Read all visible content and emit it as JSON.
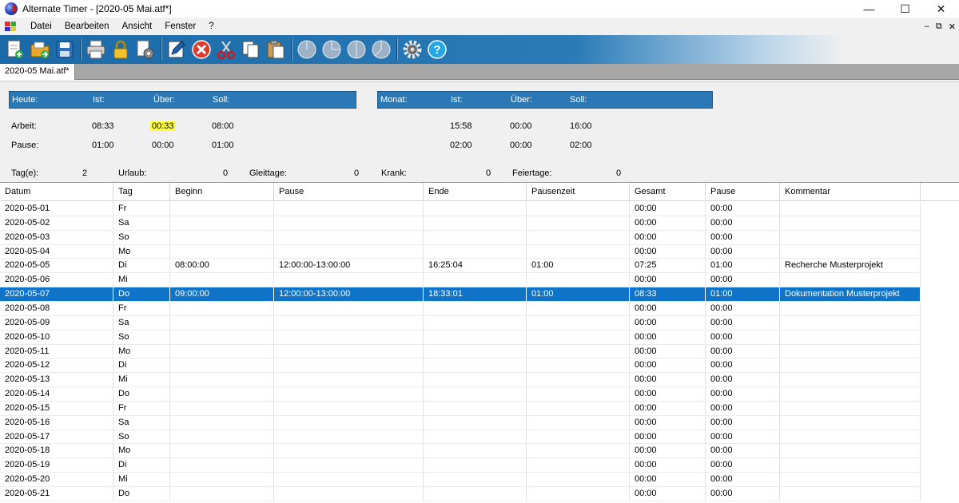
{
  "window": {
    "title": "Alternate Timer - [2020-05 Mai.atf*]"
  },
  "menu": {
    "items": [
      "Datei",
      "Bearbeiten",
      "Ansicht",
      "Fenster",
      "?"
    ]
  },
  "toolbar": {
    "buttons": [
      "new-file",
      "open-folder",
      "save",
      "print",
      "lock",
      "settings-document",
      "edit-note",
      "delete",
      "cut",
      "copy",
      "paste",
      "chart-pie-1",
      "chart-pie-2",
      "chart-pie-3",
      "chart-pie-4",
      "options-gear",
      "help"
    ]
  },
  "tab": {
    "label": "2020-05 Mai.atf*"
  },
  "today": {
    "header": {
      "title": "Heute:",
      "ist": "Ist:",
      "ueber": "Über:",
      "soll": "Soll:"
    },
    "arbeit": {
      "label": "Arbeit:",
      "ist": "08:33",
      "ueber": "00:33",
      "soll": "08:00"
    },
    "pause": {
      "label": "Pause:",
      "ist": "01:00",
      "ueber": "00:00",
      "soll": "01:00"
    }
  },
  "month": {
    "header": {
      "title": "Monat:",
      "ist": "Ist:",
      "ueber": "Über:",
      "soll": "Soll:"
    },
    "arbeit": {
      "ist": "15:58",
      "ueber": "00:00",
      "soll": "16:00"
    },
    "pause": {
      "ist": "02:00",
      "ueber": "00:00",
      "soll": "02:00"
    }
  },
  "counts": {
    "tage_label": "Tag(e):",
    "tage": "2",
    "urlaub_label": "Urlaub:",
    "urlaub": "0",
    "gleittage_label": "Gleittage:",
    "gleittage": "0",
    "krank_label": "Krank:",
    "krank": "0",
    "feiertage_label": "Feiertage:",
    "feiertage": "0"
  },
  "table": {
    "columns": [
      "Datum",
      "Tag",
      "Beginn",
      "Pause",
      "Ende",
      "Pausenzeit",
      "Gesamt",
      "Pause",
      "Kommentar"
    ],
    "selected_index": 6,
    "rows": [
      [
        "2020-05-01",
        "Fr",
        "",
        "",
        "",
        "",
        "00:00",
        "00:00",
        ""
      ],
      [
        "2020-05-02",
        "Sa",
        "",
        "",
        "",
        "",
        "00:00",
        "00:00",
        ""
      ],
      [
        "2020-05-03",
        "So",
        "",
        "",
        "",
        "",
        "00:00",
        "00:00",
        ""
      ],
      [
        "2020-05-04",
        "Mo",
        "",
        "",
        "",
        "",
        "00:00",
        "00:00",
        ""
      ],
      [
        "2020-05-05",
        "Di",
        "08:00:00",
        "12:00:00-13:00:00",
        "16:25:04",
        "01:00",
        "07:25",
        "01:00",
        "Recherche Musterprojekt"
      ],
      [
        "2020-05-06",
        "Mi",
        "",
        "",
        "",
        "",
        "00:00",
        "00:00",
        ""
      ],
      [
        "2020-05-07",
        "Do",
        "09:00:00",
        "12:00:00-13:00:00",
        "18:33:01",
        "01:00",
        "08:33",
        "01:00",
        "Dokumentation Musterprojekt"
      ],
      [
        "2020-05-08",
        "Fr",
        "",
        "",
        "",
        "",
        "00:00",
        "00:00",
        ""
      ],
      [
        "2020-05-09",
        "Sa",
        "",
        "",
        "",
        "",
        "00:00",
        "00:00",
        ""
      ],
      [
        "2020-05-10",
        "So",
        "",
        "",
        "",
        "",
        "00:00",
        "00:00",
        ""
      ],
      [
        "2020-05-11",
        "Mo",
        "",
        "",
        "",
        "",
        "00:00",
        "00:00",
        ""
      ],
      [
        "2020-05-12",
        "Di",
        "",
        "",
        "",
        "",
        "00:00",
        "00:00",
        ""
      ],
      [
        "2020-05-13",
        "Mi",
        "",
        "",
        "",
        "",
        "00:00",
        "00:00",
        ""
      ],
      [
        "2020-05-14",
        "Do",
        "",
        "",
        "",
        "",
        "00:00",
        "00:00",
        ""
      ],
      [
        "2020-05-15",
        "Fr",
        "",
        "",
        "",
        "",
        "00:00",
        "00:00",
        ""
      ],
      [
        "2020-05-16",
        "Sa",
        "",
        "",
        "",
        "",
        "00:00",
        "00:00",
        ""
      ],
      [
        "2020-05-17",
        "So",
        "",
        "",
        "",
        "",
        "00:00",
        "00:00",
        ""
      ],
      [
        "2020-05-18",
        "Mo",
        "",
        "",
        "",
        "",
        "00:00",
        "00:00",
        ""
      ],
      [
        "2020-05-19",
        "Di",
        "",
        "",
        "",
        "",
        "00:00",
        "00:00",
        ""
      ],
      [
        "2020-05-20",
        "Mi",
        "",
        "",
        "",
        "",
        "00:00",
        "00:00",
        ""
      ],
      [
        "2020-05-21",
        "Do",
        "",
        "",
        "",
        "",
        "00:00",
        "00:00",
        ""
      ]
    ]
  },
  "colors": {
    "header_blue": "#2a78b5",
    "selection_blue": "#0f74c8",
    "highlight_yellow": "#ffff3a"
  }
}
